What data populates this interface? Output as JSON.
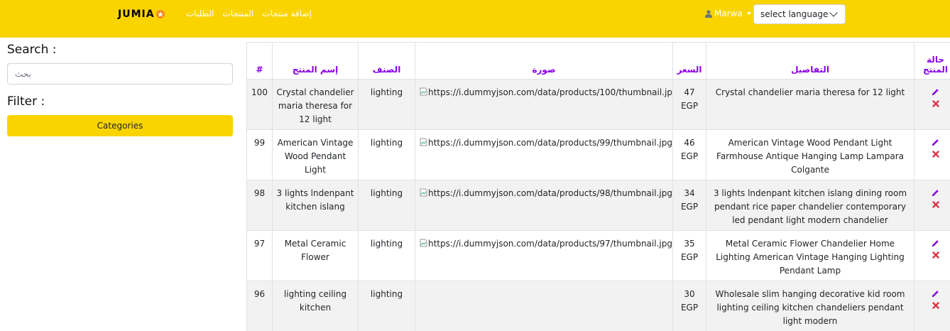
{
  "navbar": {
    "brand": "JUMIA",
    "links": [
      "الطلبات",
      "إضافة منتجات",
      "المنتجات"
    ],
    "user": "Marwa",
    "language_select": "select language",
    "bg_color": "#fad400"
  },
  "sidebar": {
    "search_title": "Search :",
    "search_placeholder": "بحث",
    "filter_title": "Filter :",
    "categories_button": "Categories"
  },
  "table": {
    "headers": {
      "id": "#",
      "name": "إسم المنتج",
      "category": "الصنف",
      "image": "صورة",
      "price": "السعر",
      "details": "التفاصيل",
      "status": "حالة المنتج"
    },
    "rows": [
      {
        "id": "100",
        "name": "Crystal chandelier maria theresa for 12 light",
        "category": "lighting",
        "image": "https://i.dummyjson.com/data/products/100/thumbnail.jpg",
        "price": "47 EGP",
        "details": "Crystal chandelier maria theresa for 12 light"
      },
      {
        "id": "99",
        "name": "American Vintage Wood Pendant Light",
        "category": "lighting",
        "image": "https://i.dummyjson.com/data/products/99/thumbnail.jpg",
        "price": "46 EGP",
        "details": "American Vintage Wood Pendant Light Farmhouse Antique Hanging Lamp Lampara Colgante"
      },
      {
        "id": "98",
        "name": "3 lights lndenpant kitchen islang",
        "category": "lighting",
        "image": "https://i.dummyjson.com/data/products/98/thumbnail.jpg",
        "price": "34 EGP",
        "details": "3 lights lndenpant kitchen islang dining room pendant rice paper chandelier contemporary led pendant light modern chandelier"
      },
      {
        "id": "97",
        "name": "Metal Ceramic Flower",
        "category": "lighting",
        "image": "https://i.dummyjson.com/data/products/97/thumbnail.jpg",
        "price": "35 EGP",
        "details": "Metal Ceramic Flower Chandelier Home Lighting American Vintage Hanging Lighting Pendant Lamp"
      },
      {
        "id": "96",
        "name": "lighting ceiling kitchen",
        "category": "lighting",
        "image": "",
        "price": "30 EGP",
        "details": "Wholesale slim hanging decorative kid room lighting ceiling kitchen chandeliers pendant light modern"
      }
    ]
  }
}
